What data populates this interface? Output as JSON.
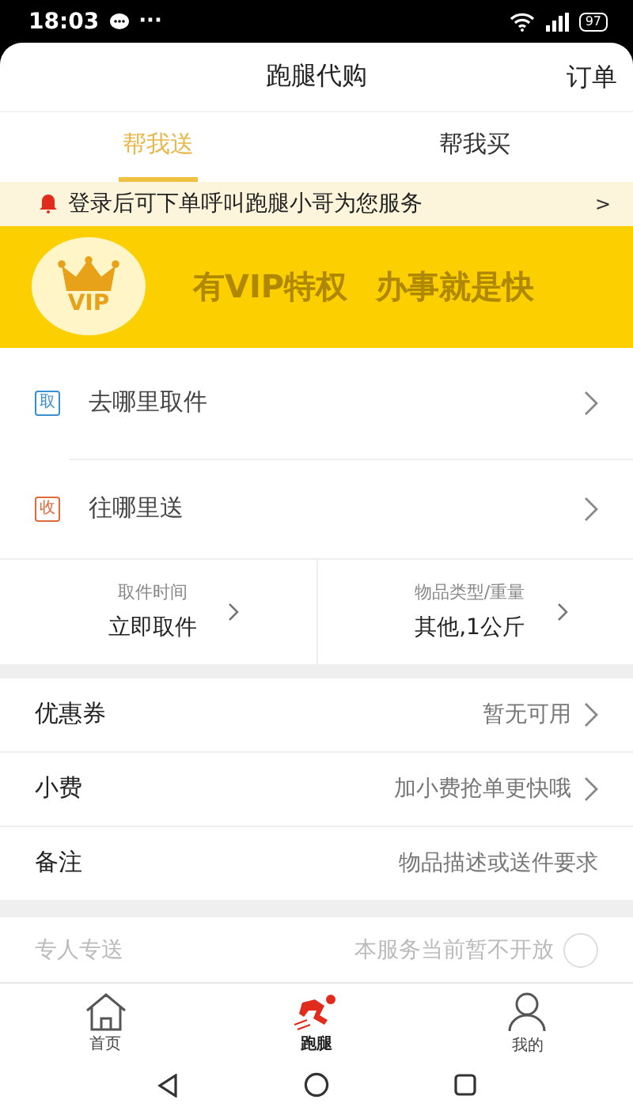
{
  "status_bar": {
    "time": "18:03",
    "dots": "···",
    "battery": "97"
  },
  "header": {
    "title": "跑腿代购",
    "action": "订单"
  },
  "tabs": [
    {
      "label": "帮我送",
      "selected": true
    },
    {
      "label": "帮我买",
      "selected": false
    }
  ],
  "notice": {
    "text": "登录后可下单呼叫跑腿小哥为您服务",
    "arrow": ">"
  },
  "banner": {
    "badge": "VIP",
    "slogan": "有VIP特权",
    "slogan_2": "办事就是快"
  },
  "addresses": [
    {
      "tag": "取",
      "color": "#3a8fd0",
      "placeholder": "去哪里取件"
    },
    {
      "tag": "收",
      "color": "#e06a3a",
      "placeholder": "往哪里送"
    }
  ],
  "details": [
    {
      "label": "取件时间",
      "value": "立即取件"
    },
    {
      "label": "物品类型/重量",
      "value": "其他,1公斤"
    }
  ],
  "options": [
    {
      "label": "优惠券",
      "value": "暂无可用",
      "kind": "link"
    },
    {
      "label": "小费",
      "value": "加小费抢单更快哦",
      "kind": "link"
    },
    {
      "label": "备注",
      "placeholder": "物品描述或送件要求",
      "kind": "input"
    }
  ],
  "exclusive": {
    "label": "专人专送",
    "note": "本服务当前暂不开放",
    "on": false,
    "disabled": true
  },
  "bottom_tabs": [
    {
      "label": "首页",
      "kind": "home",
      "selected": false
    },
    {
      "label": "跑腿",
      "kind": "runner",
      "selected": true
    },
    {
      "label": "我的",
      "kind": "person",
      "selected": false
    }
  ]
}
